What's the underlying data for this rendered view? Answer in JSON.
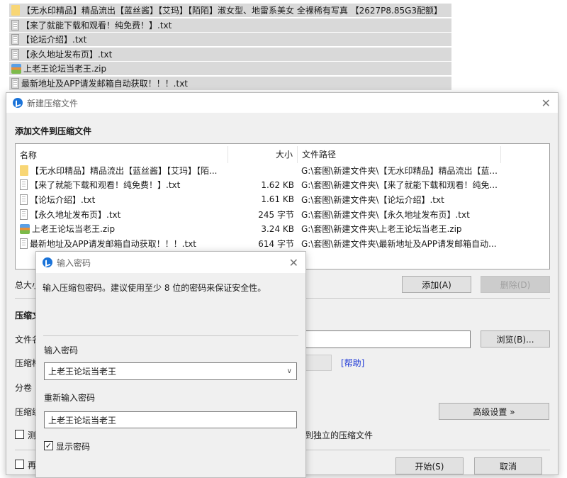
{
  "background_list": [
    {
      "icon": "folder",
      "name": "【无水印精品】精品流出【蓝丝酱】【艾玛】【陌陌】淑女型、地雷系美女 全裸稀有写真 【2627P8.85G3配额】"
    },
    {
      "icon": "txt",
      "name": "【来了就能下载和观看！纯免费！】.txt"
    },
    {
      "icon": "txt",
      "name": "【论坛介绍】.txt"
    },
    {
      "icon": "txt",
      "name": "【永久地址发布页】.txt"
    },
    {
      "icon": "zip",
      "name": "上老王论坛当老王.zip"
    },
    {
      "icon": "txt",
      "name": "最新地址及APP请发邮箱自动获取！！！.txt"
    }
  ],
  "main_dialog": {
    "title": "新建压缩文件",
    "heading": "添加文件到压缩文件",
    "columns": {
      "name": "名称",
      "size": "大小",
      "path": "文件路径"
    },
    "files": [
      {
        "icon": "folder",
        "name": "【无水印精品】精品流出【蓝丝酱】【艾玛】【陌...",
        "size": "",
        "path": "G:\\套图\\新建文件夹\\【无水印精品】精品流出【蓝..."
      },
      {
        "icon": "txt",
        "name": "【来了就能下载和观看！纯免费！】.txt",
        "size": "1.62 KB",
        "path": "G:\\套图\\新建文件夹\\【来了就能下载和观看！纯免..."
      },
      {
        "icon": "txt",
        "name": "【论坛介绍】.txt",
        "size": "1.61 KB",
        "path": "G:\\套图\\新建文件夹\\【论坛介绍】.txt"
      },
      {
        "icon": "txt",
        "name": "【永久地址发布页】.txt",
        "size": "245 字节",
        "path": "G:\\套图\\新建文件夹\\【永久地址发布页】.txt"
      },
      {
        "icon": "zip",
        "name": "上老王论坛当老王.zip",
        "size": "3.24 KB",
        "path": "G:\\套图\\新建文件夹\\上老王论坛当老王.zip"
      },
      {
        "icon": "txt",
        "name": "最新地址及APP请发邮箱自动获取！！！.txt",
        "size": "614 字节",
        "path": "G:\\套图\\新建文件夹\\最新地址及APP请发邮箱自动..."
      }
    ],
    "total_label": "总大小",
    "add_button": "添加(A)",
    "delete_button": "删除(D)",
    "section_label": "压缩文",
    "filename_label": "文件名",
    "browse_button": "浏览(B)...",
    "format_label": "压缩格",
    "help_link": "[帮助]",
    "volume_label": "分卷",
    "level_label": "压缩级",
    "advanced_button": "高级设置 »",
    "test_checkbox_label": "测",
    "separate_label": "到独立的压缩文件",
    "bottom_checkbox_label": "再",
    "start_button": "开始(S)",
    "cancel_button": "取消"
  },
  "password_dialog": {
    "title": "输入密码",
    "hint": "输入压缩包密码。建议使用至少 8 位的密码来保证安全性。",
    "password_label": "输入密码",
    "password_value": "上老王论坛当老王",
    "confirm_label": "重新输入密码",
    "confirm_value": "上老王论坛当老王",
    "show_password_label": "显示密码",
    "show_password_checked": true
  }
}
